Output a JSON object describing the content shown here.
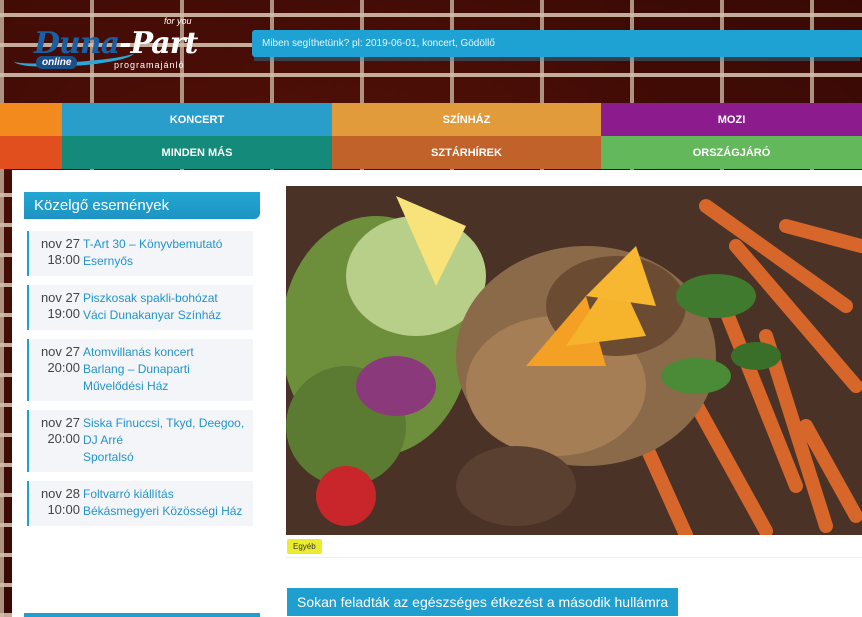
{
  "header": {
    "logo_text": "Duna-Part",
    "logo_online": "online",
    "logo_tagline": "programajánló",
    "logo_top": "for you",
    "search_placeholder": "Miben segíthetünk? pl: 2019-06-01, koncert, Gödöllő"
  },
  "nav": {
    "row1": [
      {
        "label": "KONCERT",
        "color": "#2a9ecb"
      },
      {
        "label": "SZÍNHÁZ",
        "color": "#e29b3a"
      },
      {
        "label": "MOZI",
        "color": "#8c1b8e"
      }
    ],
    "row2": [
      {
        "label": "MINDEN MÁS",
        "color": "#138a7a"
      },
      {
        "label": "SZTÁRHÍREK",
        "color": "#c0622a"
      },
      {
        "label": "ORSZÁGJÁRÓ",
        "color": "#63b85c"
      }
    ],
    "cap_colors": [
      "#f28a1e",
      "#e24f1f"
    ]
  },
  "sidebar": {
    "title": "Közelgő események",
    "events": [
      {
        "day": "nov 27",
        "time": "18:00",
        "title": "T-Art 30 – Könyvbemutató",
        "venue": "Esernyős"
      },
      {
        "day": "nov 27",
        "time": "19:00",
        "title": "Piszkosak spakli-bohózat",
        "venue": "Váci Dunakanyar Színház"
      },
      {
        "day": "nov 27",
        "time": "20:00",
        "title": "Atomvillanás koncert",
        "venue": "Barlang – Dunaparti Művelődési Ház"
      },
      {
        "day": "nov 27",
        "time": "20:00",
        "title": "Siska Finuccsi, Tkyd, Deegoo, DJ Arré",
        "venue": "Sportalsó"
      },
      {
        "day": "nov 28",
        "time": "10:00",
        "title": "Foltvarró kiállítás",
        "venue": "Békásmegyeri Közösségi Ház"
      }
    ]
  },
  "article": {
    "tag": "Egyéb",
    "title": "Sokan feladták az egészséges étkezést a második hullámra",
    "image_alt": "grilled chicken salad with orange slices and sweet potato fries"
  },
  "colors": {
    "accent": "#1e9fcf",
    "tag_bg": "#ecec2e"
  }
}
